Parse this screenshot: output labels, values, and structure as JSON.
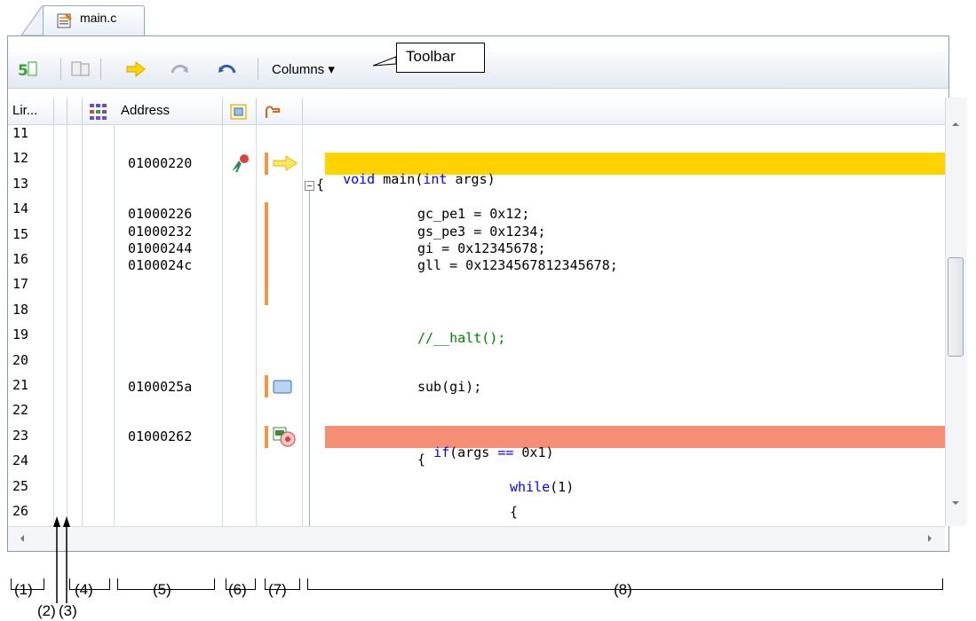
{
  "tab": {
    "label": "main.c",
    "icon": "c-source-file-icon"
  },
  "toolbar": {
    "buttons": [
      "source-display-icon",
      "disassemble-display-icon",
      "current-pc-icon",
      "forward-icon",
      "back-icon"
    ],
    "columns_label": "Columns ▾"
  },
  "callout": {
    "label": "Toolbar"
  },
  "headers": {
    "line": "Lir...",
    "address": "Address",
    "icon6": "event-column-icon",
    "icon7": "main-area-icon"
  },
  "lines": [
    "11",
    "12",
    "13",
    "14",
    "15",
    "16",
    "17",
    "18",
    "19",
    "20",
    "21",
    "22",
    "23",
    "24",
    "25",
    "26"
  ],
  "addresses": [
    {
      "line": "12",
      "value": "01000220"
    },
    {
      "line": "14",
      "value": "01000226"
    },
    {
      "line": "15",
      "value": "01000232"
    },
    {
      "line": "16",
      "value": "01000244"
    },
    {
      "line": "17",
      "value": "0100024c"
    },
    {
      "line": "21",
      "value": "0100025a"
    },
    {
      "line": "23",
      "value": "01000262"
    }
  ],
  "code": {
    "l12": "void main(int args)",
    "l13": "{",
    "l14": "gc_pe1 = 0x12;",
    "l15": "gs_pe3 = 0x1234;",
    "l16": "gi = 0x12345678;",
    "l17": "gll = 0x1234567812345678;",
    "l19": "//__halt();",
    "l21": "sub(gi);",
    "l23": "if(args == 0x1)",
    "l24": "{",
    "l25": "while(1)",
    "l26": "{"
  },
  "callout_labels": [
    "(1)",
    "(2)",
    "(3)",
    "(4)",
    "(5)",
    "(6)",
    "(7)",
    "(8)"
  ],
  "colors": {
    "current_line": "#ffd200",
    "breakpoint_line": "#f48e74",
    "keyword": "#0000ff",
    "comment": "#008000"
  }
}
